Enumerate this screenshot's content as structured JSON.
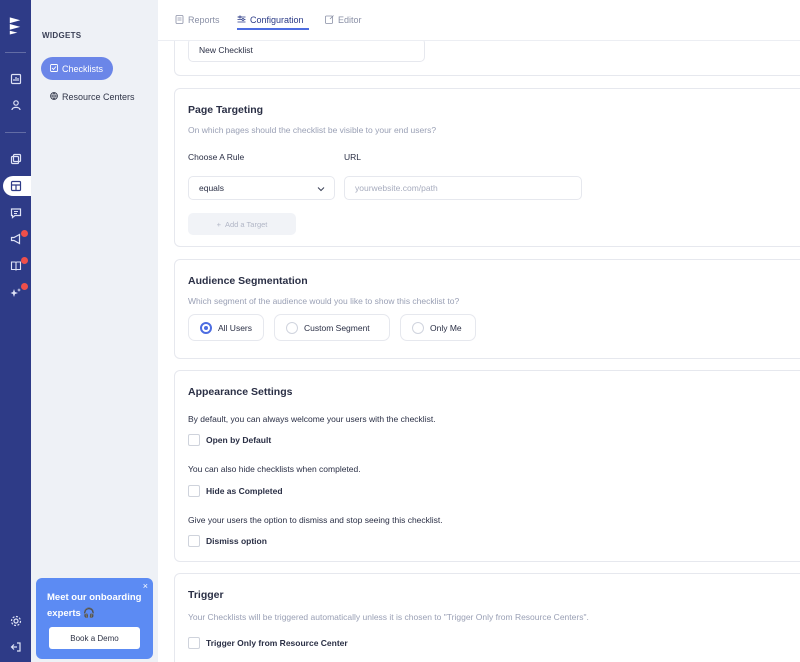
{
  "rail": {
    "icons": [
      "logo-icon",
      "dashboard-icon",
      "user-icon",
      "tours-icon",
      "widgets-icon",
      "chat-icon",
      "megaphone-icon",
      "book-icon",
      "sparkles-icon",
      "settings-icon",
      "logout-icon"
    ],
    "active": "widgets-icon"
  },
  "sidebar": {
    "section_title": "WIDGETS",
    "items": [
      {
        "label": "Checklists",
        "icon": "checklist-icon",
        "active": true
      },
      {
        "label": "Resource Centers",
        "icon": "globe-icon",
        "active": false
      }
    ],
    "promo": {
      "text": "Meet our onboarding experts 🎧",
      "button": "Book a Demo",
      "close": "×"
    }
  },
  "tabs": [
    {
      "label": "Reports",
      "icon": "report-icon",
      "active": false
    },
    {
      "label": "Configuration",
      "icon": "config-icon",
      "active": true
    },
    {
      "label": "Editor",
      "icon": "editor-icon",
      "active": false
    }
  ],
  "name_card": {
    "value": "New Checklist"
  },
  "page_targeting": {
    "title": "Page Targeting",
    "subtitle": "On which pages should the checklist be visible to your end users?",
    "rule_label": "Choose A Rule",
    "url_label": "URL",
    "rule_value": "equals",
    "url_placeholder": "yourwebsite.com/path",
    "add_target": "Add a Target"
  },
  "audience": {
    "title": "Audience Segmentation",
    "subtitle": "Which segment of the audience would you like to show this checklist to?",
    "options": [
      "All Users",
      "Custom Segment",
      "Only Me"
    ],
    "selected": "All Users"
  },
  "appearance": {
    "title": "Appearance Settings",
    "desc_1": "By default, you can always welcome your users with the checklist.",
    "opt_1": "Open by Default",
    "desc_2": "You can also hide checklists when completed.",
    "opt_2": "Hide as Completed",
    "desc_3": "Give your users the option to dismiss and stop seeing this checklist.",
    "opt_3": "Dismiss option"
  },
  "trigger": {
    "title": "Trigger",
    "subtitle": "Your Checklists will be triggered automatically unless it is chosen to \"Trigger Only from Resource Centers\".",
    "opt": "Trigger Only from Resource Center"
  },
  "colors": {
    "rail": "#2e3b87",
    "accent": "#4d6de1",
    "sidebar_active": "#6b86e8",
    "promo": "#5c8bf3",
    "badge": "#ef4f4a"
  }
}
